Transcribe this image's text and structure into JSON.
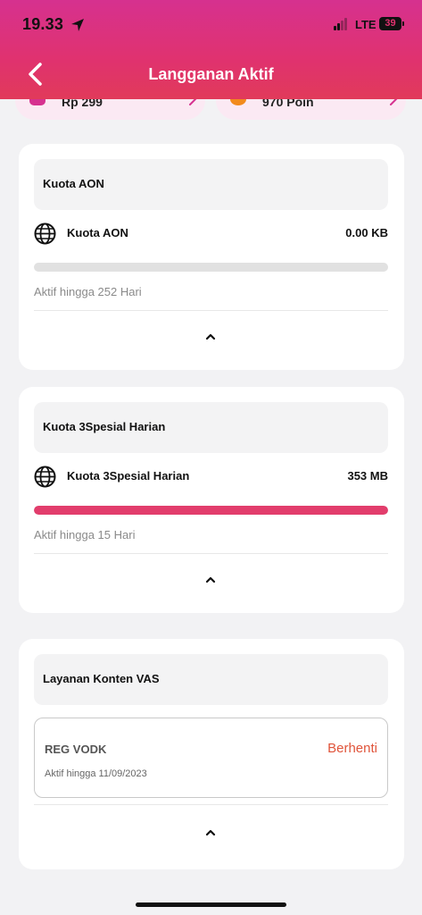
{
  "status_bar": {
    "time": "19.33",
    "network": "LTE",
    "battery": "39"
  },
  "header": {
    "title": "Langganan Aktif"
  },
  "summary_pills": [
    {
      "text": "Rp 299",
      "icon_color": "#d6318f"
    },
    {
      "text": "970 Poin",
      "icon_color": "#f28a1c"
    }
  ],
  "cards": [
    {
      "header": "Kuota AON",
      "quota_name": "Kuota AON",
      "quota_value": "0.00 KB",
      "remaining_fraction": 0,
      "active_text": "Aktif hingga 252 Hari"
    },
    {
      "header": "Kuota 3Spesial Harian",
      "quota_name": "Kuota 3Spesial Harian",
      "quota_value": "353 MB",
      "remaining_fraction": 1,
      "active_text": "Aktif hingga 15 Hari"
    }
  ],
  "vas": {
    "header": "Layanan Konten VAS",
    "service_name": "REG VODK",
    "stop_label": "Berhenti",
    "active_text": "Aktif hingga 11/09/2023"
  },
  "colors": {
    "accent": "#e23d6c",
    "header_gradient_top": "#d6318f",
    "header_gradient_bottom": "#e13a5a",
    "stop_text": "#e0543a"
  },
  "icons": {
    "back": "chevron-left-icon",
    "location": "location-arrow-icon",
    "quota": "globe-icon",
    "collapse": "chevron-up-icon",
    "pill_arrow": "chevron-right-icon"
  }
}
